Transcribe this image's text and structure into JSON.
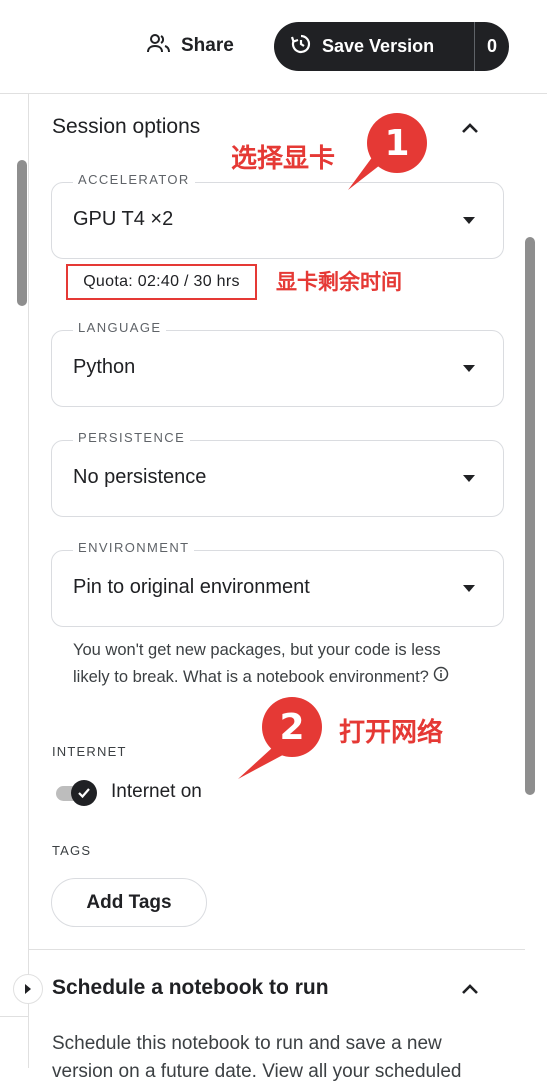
{
  "header": {
    "share_label": "Share",
    "save_version_label": "Save Version",
    "version_count": "0"
  },
  "session": {
    "title": "Session options",
    "accelerator": {
      "label": "ACCELERATOR",
      "value": "GPU T4 ×2"
    },
    "quota": "Quota: 02:40 / 30 hrs",
    "language": {
      "label": "LANGUAGE",
      "value": "Python"
    },
    "persistence": {
      "label": "PERSISTENCE",
      "value": "No persistence"
    },
    "environment": {
      "label": "ENVIRONMENT",
      "value": "Pin to original environment",
      "description": "You won't get new packages, but your code is less likely to break. What is a notebook environment?"
    },
    "internet": {
      "label": "INTERNET",
      "toggle_label": "Internet on",
      "on": true
    },
    "tags": {
      "label": "TAGS",
      "button": "Add Tags"
    }
  },
  "schedule": {
    "title": "Schedule a notebook to run",
    "description": "Schedule this notebook to run and save a new version on a future date. View all your scheduled"
  },
  "annotations": {
    "badge1": "1",
    "badge1_text": "选择显卡",
    "quota_text": "显卡剩余时间",
    "badge2": "2",
    "badge2_text": "打开网络",
    "color": "#e53935"
  }
}
